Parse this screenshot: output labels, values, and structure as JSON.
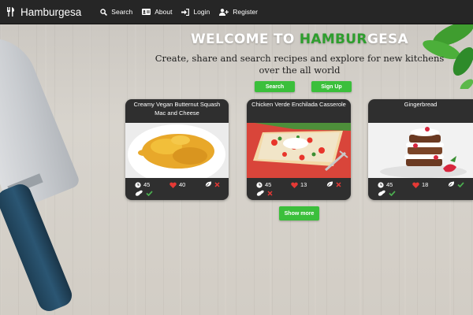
{
  "navbar": {
    "brand": "Hamburgesa",
    "items": [
      {
        "label": "Search",
        "icon": "search-icon"
      },
      {
        "label": "About",
        "icon": "id-card-icon"
      },
      {
        "label": "Login",
        "icon": "sign-in-icon"
      },
      {
        "label": "Register",
        "icon": "user-plus-icon"
      }
    ]
  },
  "hero": {
    "title_part1": "WELCOME TO ",
    "title_green": "HAMBUR",
    "title_part2": "GESA",
    "subtitle": "Create, share and search recipes and explore for new kitchens over the all world",
    "search_button": "Search",
    "signup_button": "Sign Up"
  },
  "recipes": [
    {
      "title": "Creamy Vegan Butternut Squash Mac and Cheese",
      "time": "45",
      "likes": "40"
    },
    {
      "title": "Chicken Verde Enchilada Casserole",
      "time": "45",
      "likes": "13"
    },
    {
      "title": "Gingerbread",
      "time": "45",
      "likes": "18"
    }
  ],
  "show_more": "Show more",
  "colors": {
    "navbar": "#262626",
    "accent_green": "#3bbf3b",
    "card": "#2f2f2f",
    "heart": "#e53935",
    "check": "#4caf50",
    "cross": "#e53935"
  }
}
